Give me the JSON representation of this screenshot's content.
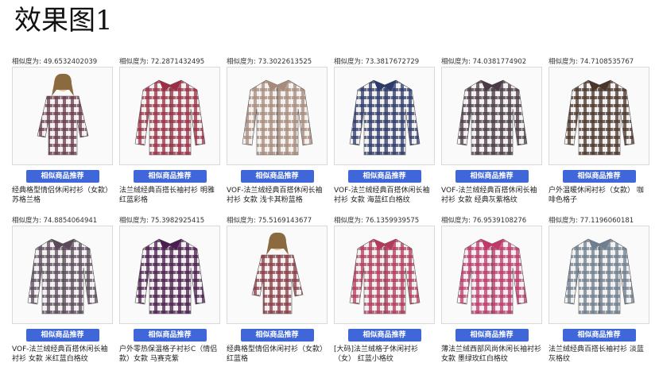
{
  "page": {
    "title": "效果图1"
  },
  "button_label": "相似商品推荐",
  "items": [
    {
      "similarity": "相似度为: 49.6532402039",
      "desc": "经典格型情侣休闲衬衫（女款） 苏格兰格",
      "color": "#6a3b4a",
      "model": true
    },
    {
      "similarity": "相似度为: 72.2871432495",
      "desc": "法兰绒经典百搭长袖衬衫 明雅红蓝彩格",
      "color": "#9b2f44",
      "model": false
    },
    {
      "similarity": "相似度为: 73.3022613525",
      "desc": "VOF-法兰绒经典百搭休闲长袖衬衫 女款 浅卡其粉蓝格",
      "color": "#a88a7a",
      "model": false
    },
    {
      "similarity": "相似度为: 73.3817672729",
      "desc": "VOF-法兰绒经典百搭休闲长袖衬衫 女款 海蓝红白格纹",
      "color": "#2c3b6b",
      "model": false
    },
    {
      "similarity": "相似度为: 74.0381774902",
      "desc": "VOF-法兰绒经典百搭休闲长袖衬衫 女款 经典灰紫格纹",
      "color": "#4a3a45",
      "model": false
    },
    {
      "similarity": "相似度为: 74.7108535767",
      "desc": "户外温暖休闲衬衫（女款） 咖啡色格子",
      "color": "#4b3428",
      "model": false
    },
    {
      "similarity": "相似度为: 74.8854064941",
      "desc": "VOF-法兰绒经典百搭休闲长袖衬衫 女款 米红蓝白格纹",
      "color": "#5a4a5a",
      "model": false
    },
    {
      "similarity": "相似度为: 75.3982925415",
      "desc": "户外零热保温格子衬衫C（情侣款）女款 马赛克紫",
      "color": "#4a1f4f",
      "model": false
    },
    {
      "similarity": "相似度为: 75.5169143677",
      "desc": "经典格型情侣休闲衬衫（女款） 红蓝格",
      "color": "#8a3a45",
      "model": true
    },
    {
      "similarity": "相似度为: 76.1359939575",
      "desc": "[大码]法兰绒格子休闲衬衫（女） 红蓝小格纹",
      "color": "#b23a5a",
      "model": false
    },
    {
      "similarity": "相似度为: 76.9539108276",
      "desc": "薄法兰绒西部风尚休闲长袖衬衫 女款 墨绿玫红白格纹",
      "color": "#c0386a",
      "model": false
    },
    {
      "similarity": "相似度为: 77.1196060181",
      "desc": "法兰绒经典百搭长袖衬衫 淡蓝灰格纹",
      "color": "#6f7f8f",
      "model": false
    }
  ]
}
